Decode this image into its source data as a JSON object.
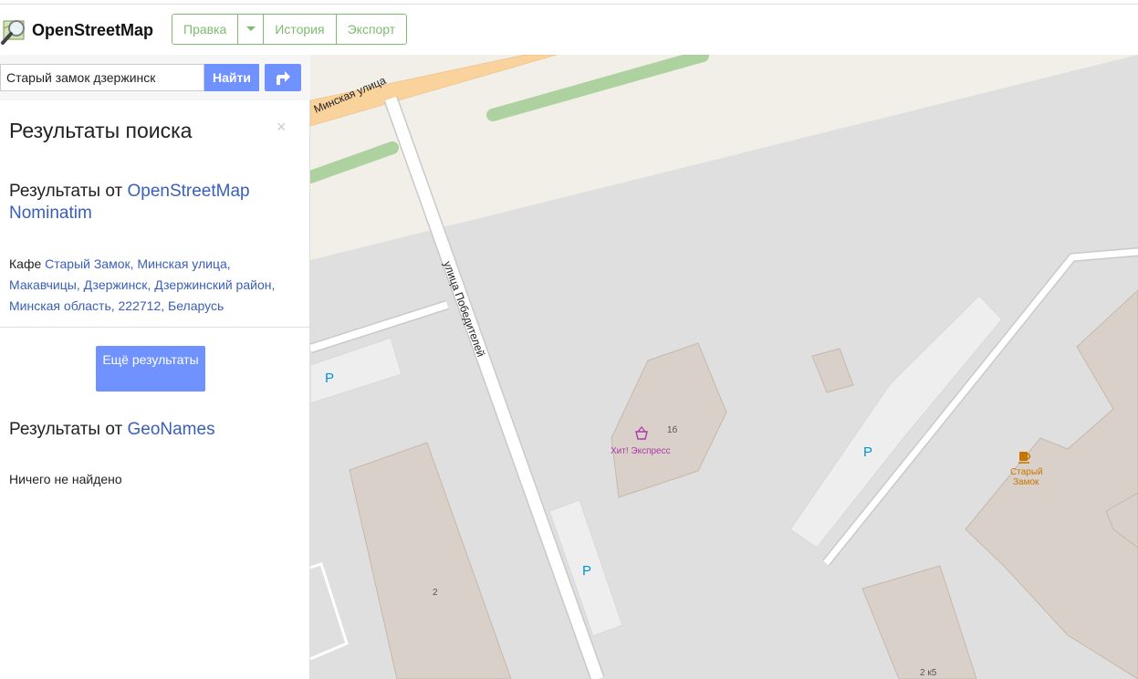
{
  "header": {
    "brand": "OpenStreetMap",
    "buttons": {
      "edit": "Правка",
      "history": "История",
      "export": "Экспорт"
    }
  },
  "search": {
    "value": "Старый замок дзержинск",
    "button": "Найти"
  },
  "results": {
    "title": "Результаты поиска",
    "close": "×",
    "nominatim": {
      "prefix": "Результаты от ",
      "link": "OpenStreetMap Nominatim",
      "item": {
        "type": "Кафе",
        "link": "Старый Замок, Минская улица, Макавчицы, Дзержинск, Дзержинский район, Минская область, 222712, Беларусь"
      }
    },
    "more_button": "Ещё результаты",
    "geonames": {
      "prefix": "Результаты от ",
      "link": "GeoNames",
      "empty": "Ничего не найдено"
    }
  },
  "map": {
    "streets": {
      "minskaya": "Минская улица",
      "pobediteley": "улица Победителей"
    },
    "parking_label": "P",
    "poi": {
      "shop": "Хит! Экспресс",
      "cafe_line1": "Старый",
      "cafe_line2": "Замок"
    },
    "house_numbers": {
      "h1b": "1б",
      "h2": "2",
      "h2k5": "2 к5"
    },
    "colors": {
      "background": "#e0dfdf",
      "road_major": "#f9d29c",
      "green": "#aed1a0",
      "building": "#d9d0c9",
      "parking": "#eeeeee",
      "landuse": "#f2efe9",
      "parking_text": "#0092da",
      "shop_text": "#ac39ac",
      "cafe_text": "#c77400"
    }
  },
  "colors": {
    "accent": "#7092ff",
    "edit_green": "#7ebc6f",
    "link": "#3a5fb8"
  }
}
